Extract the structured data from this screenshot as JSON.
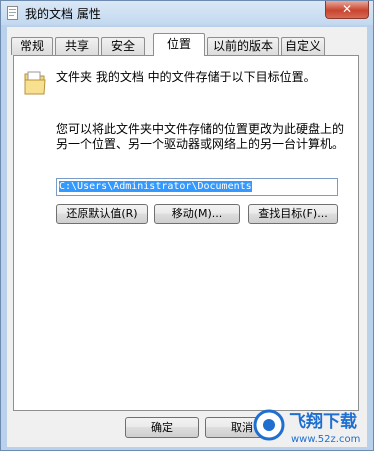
{
  "window": {
    "title": "我的文档 属性",
    "close_label": "✕"
  },
  "tabs": [
    {
      "label": "常规",
      "active": false
    },
    {
      "label": "共享",
      "active": false
    },
    {
      "label": "安全",
      "active": false
    },
    {
      "label": "位置",
      "active": true
    },
    {
      "label": "以前的版本",
      "active": false
    },
    {
      "label": "自定义",
      "active": false
    }
  ],
  "location": {
    "description": "文件夹 我的文档 中的文件存储于以下目标位置。",
    "info": "您可以将此文件夹中文件存储的位置更改为此硬盘上的另一个位置、另一个驱动器或网络上的另一台计算机。",
    "path": "C:\\Users\\Administrator\\Documents",
    "restore_label": "还原默认值(R)",
    "move_label": "移动(M)...",
    "find_label": "查找目标(F)..."
  },
  "footer": {
    "ok_label": "确定",
    "cancel_label": "取消"
  },
  "watermark": {
    "brand": "飞翔下载",
    "url": "www.52z.com"
  },
  "colors": {
    "window_frame": "#b9d1ea",
    "selection": "#3399ff",
    "close": "#c9442f",
    "watermark": "#1e6fd0"
  }
}
